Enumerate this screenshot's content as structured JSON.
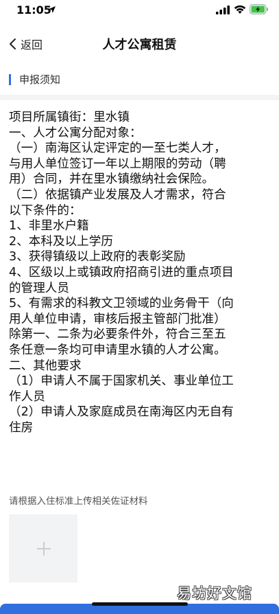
{
  "status_bar": {
    "time": "11:05"
  },
  "nav": {
    "back_label": "返回",
    "title": "人才公寓租赁"
  },
  "section": {
    "title": "申报须知"
  },
  "notice_lines": [
    "项目所属镇街：里水镇",
    "一、人才公寓分配对象：",
    "（一）南海区认定评定的一至七类人才，",
    "与用人单位签订一年以上期限的劳动（聘",
    "用）合同，并在里水镇缴纳社会保险。",
    "（二）依据镇产业发展及人才需求，符合",
    "以下条件的：",
    "1、非里水户籍",
    "2、本科及以上学历",
    "3、获得镇级以上政府的表彰奖励",
    "4、区级以上或镇政府招商引进的重点项目",
    "的管理人员",
    "5、有需求的科教文卫领域的业务骨干（向",
    "用人单位申请，审核后报主管部门批准）",
    "除第一、二条为必要条件外，符合三至五",
    "条任意一条均可申请里水镇的人才公寓。",
    "二、其他要求",
    "（1）申请人不属于国家机关、事业单位工",
    "作人员",
    "（2）申请人及家庭成员在南海区内无自有",
    "住房"
  ],
  "upload": {
    "hint": "请根据入住标准上传相关佐证材料"
  },
  "watermark": "易坊好文馆",
  "colors": {
    "accent": "#2f6fe0",
    "upload_bg": "#f2f3f5"
  }
}
